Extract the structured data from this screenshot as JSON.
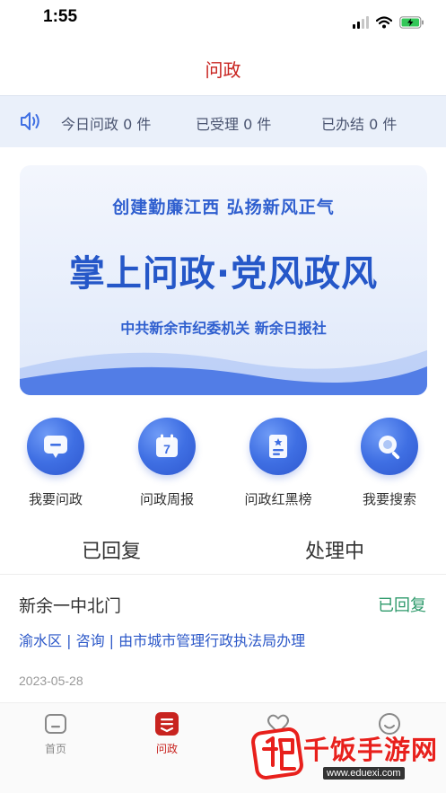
{
  "status_bar": {
    "time": "1:55"
  },
  "nav": {
    "title": "问政"
  },
  "stats": {
    "today": "今日问政 0 件",
    "accepted": "已受理 0 件",
    "completed": "已办结 0 件"
  },
  "banner": {
    "slogan": "创建勤廉江西    弘扬新风正气",
    "headline": "掌上问政·党风政风",
    "organizers": "中共新余市纪委机关  新余日报社"
  },
  "quick_actions": [
    {
      "label": "我要问政",
      "icon": "message-icon"
    },
    {
      "label": "问政周报",
      "icon": "calendar-icon"
    },
    {
      "label": "问政红黑榜",
      "icon": "ranking-board-icon"
    },
    {
      "label": "我要搜索",
      "icon": "search-icon"
    }
  ],
  "calendar_day": "7",
  "tabs": [
    {
      "label": "已回复"
    },
    {
      "label": "处理中"
    }
  ],
  "list": [
    {
      "title": "新余一中北门",
      "status": "已回复",
      "tags": "渝水区 | 咨询 | 由市城市管理行政执法局办理",
      "date": "2023-05-28"
    }
  ],
  "tabbar": [
    {
      "label": "首页",
      "icon": "home-icon"
    },
    {
      "label": "问政",
      "icon": "inquiry-icon",
      "active": true
    },
    {
      "label": "",
      "icon": "heart-icon"
    },
    {
      "label": "",
      "icon": "smile-icon"
    }
  ],
  "watermark": {
    "brand": "千饭手游网",
    "url": "www.eduexi.com"
  },
  "colors": {
    "accent_red": "#c8231f",
    "accent_blue": "#3f6fe3",
    "status_green": "#2e9a6b",
    "tag_blue": "#2c58c8"
  }
}
